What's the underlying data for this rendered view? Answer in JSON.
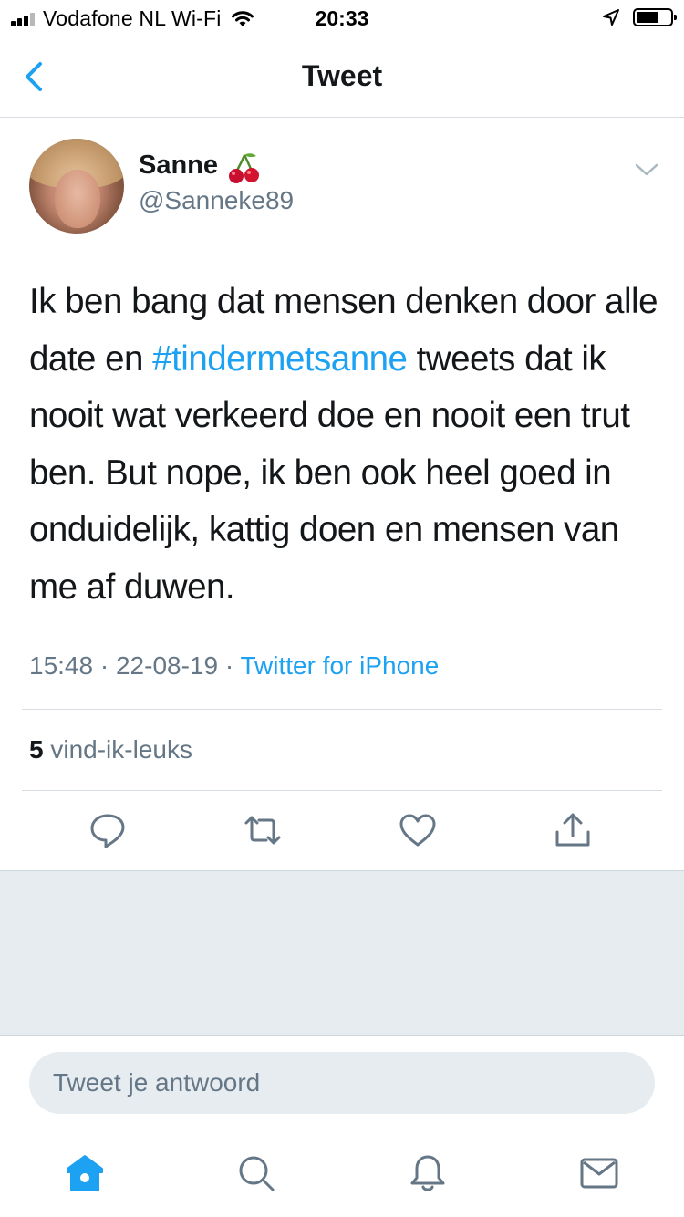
{
  "status_bar": {
    "carrier": "Vodafone NL Wi-Fi",
    "time": "20:33",
    "icons": [
      "signal-icon",
      "wifi-icon",
      "location-icon",
      "battery-icon"
    ]
  },
  "nav": {
    "title": "Tweet",
    "back_icon": "chevron-left-icon"
  },
  "tweet": {
    "author_name": "Sanne",
    "author_emoji": "cherries-icon",
    "author_handle": "@Sanneke89",
    "text_before": "Ik ben bang dat mensen denken door alle date en ",
    "hashtag": "#tindermetsanne",
    "text_after": " tweets dat ik nooit wat verkeerd doe en nooit een trut ben. But nope, ik ben ook heel goed in onduidelijk, kattig doen en mensen van me af duwen.",
    "time": "15:48",
    "date": "22-08-19",
    "source": "Twitter for iPhone",
    "likes_count": "5",
    "likes_label": "vind-ik-leuks"
  },
  "actions": [
    "reply-icon",
    "retweet-icon",
    "like-icon",
    "share-icon"
  ],
  "reply": {
    "placeholder": "Tweet je antwoord"
  },
  "tab_bar": [
    "home-icon",
    "search-icon",
    "notifications-icon",
    "messages-icon"
  ],
  "colors": {
    "accent": "#1da1f2",
    "secondary_text": "#657786",
    "background_gray": "#e6ecf0"
  }
}
